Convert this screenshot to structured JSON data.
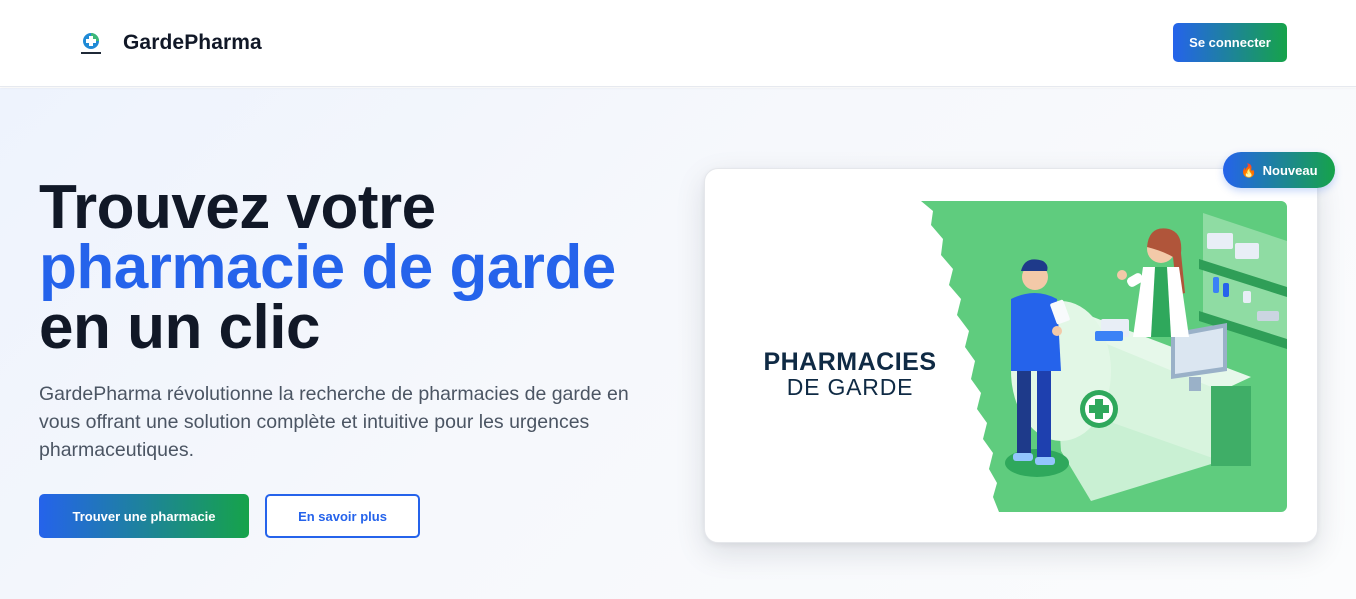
{
  "header": {
    "brand": "GardePharma",
    "logo_icon": "pharmacy-cross-logo",
    "login_label": "Se connecter"
  },
  "hero": {
    "title_line1": "Trouvez votre",
    "title_line2": "pharmacie de garde",
    "title_line3": "en un clic",
    "description": "GardePharma révolutionne la recherche de pharmacies de garde en vous offrant une solution complète et intuitive pour les urgences pharmaceutiques.",
    "primary_cta": "Trouver une pharmacie",
    "secondary_cta": "En savoir plus"
  },
  "card": {
    "title_line1": "PHARMACIES",
    "title_line2": "DE GARDE",
    "illustration_icon": "pharmacist-counter-illustration"
  },
  "badge": {
    "icon": "fire-icon",
    "label": "Nouveau"
  },
  "colors": {
    "primary_blue": "#2563eb",
    "primary_green": "#16a34a",
    "text_dark": "#111827",
    "illustration_green": "#5fcc7e"
  }
}
